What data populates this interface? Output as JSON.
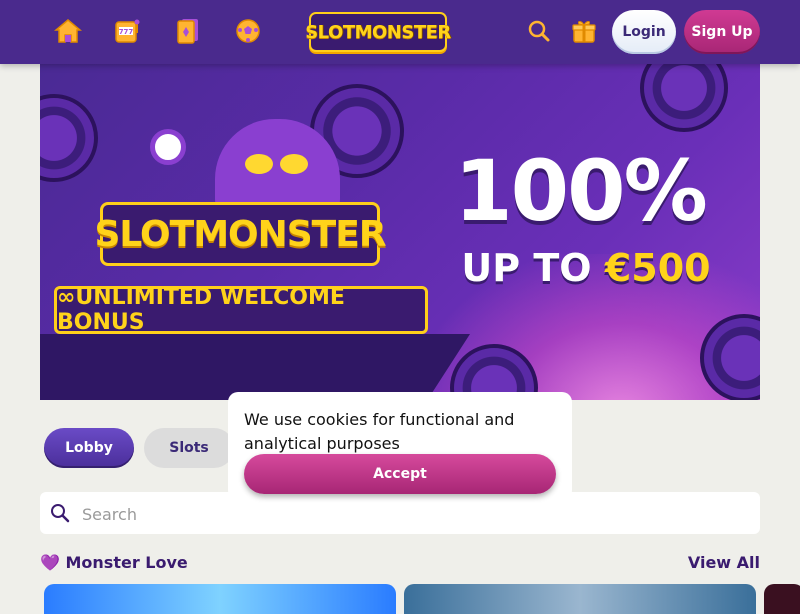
{
  "header": {
    "nav_icons": [
      "home-icon",
      "slot-machine-icon",
      "cards-icon",
      "soccer-ball-icon"
    ],
    "logo_text": "SLOTMONSTER",
    "actions": [
      "search-icon",
      "gift-icon"
    ],
    "login_label": "Login",
    "signup_label": "Sign Up"
  },
  "banner": {
    "brand_text": "SLOTMONSTER",
    "bonus_text": "∞UNLIMITED WELCOME BONUS",
    "headline": "100%",
    "subline_prefix": "UP TO ",
    "subline_amount": "€500"
  },
  "tabs": [
    {
      "label": "Lobby",
      "active": true
    },
    {
      "label": "Slots",
      "active": false
    }
  ],
  "cookie": {
    "message": "We use cookies for functional and analytical purposes",
    "accept_label": "Accept"
  },
  "search": {
    "placeholder": "Search"
  },
  "section": {
    "title": "💜 Monster Love",
    "view_all_label": "View All"
  },
  "colors": {
    "header_bg": "#4a2a8d",
    "accent_yellow": "#ffd31a",
    "signup_pink": "#c43389",
    "tab_active": "#5a3bb0",
    "page_bg": "#efefea"
  }
}
